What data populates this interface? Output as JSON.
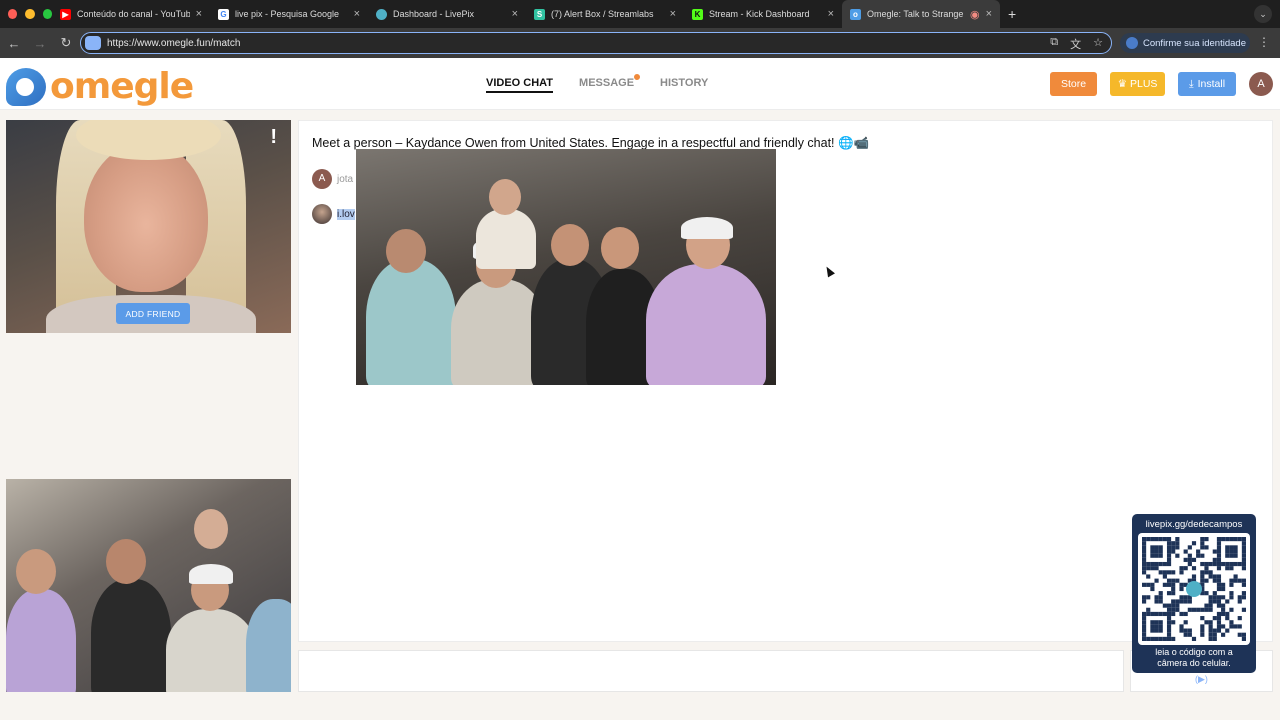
{
  "browser": {
    "traffic_colors": [
      "#ff5f57",
      "#febc2e",
      "#28c840"
    ],
    "tabs": [
      {
        "label": "Conteúdo do canal - YouTube",
        "icon": "youtube-icon",
        "color": "#ff0000"
      },
      {
        "label": "live pix - Pesquisa Google",
        "icon": "google-icon",
        "color": "#ffffff"
      },
      {
        "label": "Dashboard - LivePix",
        "icon": "livepix-icon",
        "color": "#4fb0c6"
      },
      {
        "label": "(7) Alert Box / Streamlabs",
        "icon": "streamlabs-icon",
        "color": "#31c3a2"
      },
      {
        "label": "Stream - Kick Dashboard",
        "icon": "kick-icon",
        "color": "#53fc18"
      },
      {
        "label": "Omegle: Talk to Strangers!",
        "icon": "omegle-icon",
        "color": "#4e9de6"
      }
    ],
    "url": "https://www.omegle.fun/match",
    "identity_label": "Confirme sua identidade"
  },
  "header": {
    "logo_text": "omegle",
    "nav": [
      "VIDEO CHAT",
      "MESSAGE",
      "HISTORY"
    ],
    "store_label": "Store",
    "plus_label": "PLUS",
    "install_label": "Install",
    "avatar_letter": "A"
  },
  "stranger": {
    "report_label": "!",
    "add_friend_label": "ADD FRIEND"
  },
  "chat": {
    "intro": "Meet a person – Kaydance Owen from United States. Engage in a respectful and friendly chat! 🌐📹",
    "messages": [
      {
        "avatar": "A",
        "text": "jota"
      },
      {
        "avatar": "",
        "text": "i.lov"
      }
    ]
  },
  "qr": {
    "url": "livepix.gg/dedecampos",
    "caption_1": "leia o código com a",
    "caption_2": "câmera do celular.",
    "play_label": "(▶)"
  }
}
